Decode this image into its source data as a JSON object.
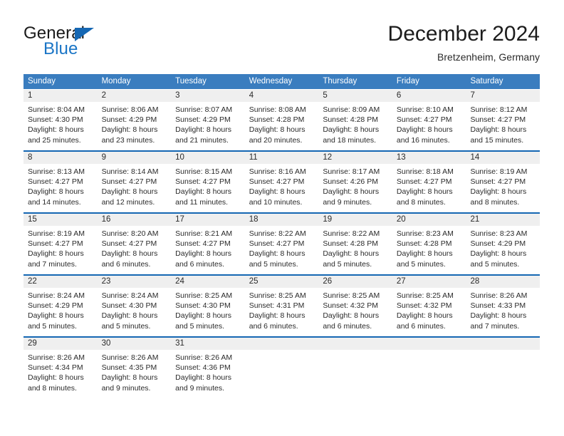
{
  "brand": {
    "name_primary": "General",
    "name_secondary": "Blue",
    "accent_color": "#1567b3"
  },
  "header": {
    "month_title": "December 2024",
    "location": "Bretzenheim, Germany"
  },
  "theme": {
    "header_blue": "#3a7dbf",
    "rule_blue": "#1567b3",
    "daynum_gray": "#efefef",
    "text_color": "#2a2a2a"
  },
  "weekdays": [
    "Sunday",
    "Monday",
    "Tuesday",
    "Wednesday",
    "Thursday",
    "Friday",
    "Saturday"
  ],
  "weeks": [
    [
      {
        "day": "1",
        "sunrise": "Sunrise: 8:04 AM",
        "sunset": "Sunset: 4:30 PM",
        "daylight_1": "Daylight: 8 hours",
        "daylight_2": "and 25 minutes."
      },
      {
        "day": "2",
        "sunrise": "Sunrise: 8:06 AM",
        "sunset": "Sunset: 4:29 PM",
        "daylight_1": "Daylight: 8 hours",
        "daylight_2": "and 23 minutes."
      },
      {
        "day": "3",
        "sunrise": "Sunrise: 8:07 AM",
        "sunset": "Sunset: 4:29 PM",
        "daylight_1": "Daylight: 8 hours",
        "daylight_2": "and 21 minutes."
      },
      {
        "day": "4",
        "sunrise": "Sunrise: 8:08 AM",
        "sunset": "Sunset: 4:28 PM",
        "daylight_1": "Daylight: 8 hours",
        "daylight_2": "and 20 minutes."
      },
      {
        "day": "5",
        "sunrise": "Sunrise: 8:09 AM",
        "sunset": "Sunset: 4:28 PM",
        "daylight_1": "Daylight: 8 hours",
        "daylight_2": "and 18 minutes."
      },
      {
        "day": "6",
        "sunrise": "Sunrise: 8:10 AM",
        "sunset": "Sunset: 4:27 PM",
        "daylight_1": "Daylight: 8 hours",
        "daylight_2": "and 16 minutes."
      },
      {
        "day": "7",
        "sunrise": "Sunrise: 8:12 AM",
        "sunset": "Sunset: 4:27 PM",
        "daylight_1": "Daylight: 8 hours",
        "daylight_2": "and 15 minutes."
      }
    ],
    [
      {
        "day": "8",
        "sunrise": "Sunrise: 8:13 AM",
        "sunset": "Sunset: 4:27 PM",
        "daylight_1": "Daylight: 8 hours",
        "daylight_2": "and 14 minutes."
      },
      {
        "day": "9",
        "sunrise": "Sunrise: 8:14 AM",
        "sunset": "Sunset: 4:27 PM",
        "daylight_1": "Daylight: 8 hours",
        "daylight_2": "and 12 minutes."
      },
      {
        "day": "10",
        "sunrise": "Sunrise: 8:15 AM",
        "sunset": "Sunset: 4:27 PM",
        "daylight_1": "Daylight: 8 hours",
        "daylight_2": "and 11 minutes."
      },
      {
        "day": "11",
        "sunrise": "Sunrise: 8:16 AM",
        "sunset": "Sunset: 4:27 PM",
        "daylight_1": "Daylight: 8 hours",
        "daylight_2": "and 10 minutes."
      },
      {
        "day": "12",
        "sunrise": "Sunrise: 8:17 AM",
        "sunset": "Sunset: 4:26 PM",
        "daylight_1": "Daylight: 8 hours",
        "daylight_2": "and 9 minutes."
      },
      {
        "day": "13",
        "sunrise": "Sunrise: 8:18 AM",
        "sunset": "Sunset: 4:27 PM",
        "daylight_1": "Daylight: 8 hours",
        "daylight_2": "and 8 minutes."
      },
      {
        "day": "14",
        "sunrise": "Sunrise: 8:19 AM",
        "sunset": "Sunset: 4:27 PM",
        "daylight_1": "Daylight: 8 hours",
        "daylight_2": "and 8 minutes."
      }
    ],
    [
      {
        "day": "15",
        "sunrise": "Sunrise: 8:19 AM",
        "sunset": "Sunset: 4:27 PM",
        "daylight_1": "Daylight: 8 hours",
        "daylight_2": "and 7 minutes."
      },
      {
        "day": "16",
        "sunrise": "Sunrise: 8:20 AM",
        "sunset": "Sunset: 4:27 PM",
        "daylight_1": "Daylight: 8 hours",
        "daylight_2": "and 6 minutes."
      },
      {
        "day": "17",
        "sunrise": "Sunrise: 8:21 AM",
        "sunset": "Sunset: 4:27 PM",
        "daylight_1": "Daylight: 8 hours",
        "daylight_2": "and 6 minutes."
      },
      {
        "day": "18",
        "sunrise": "Sunrise: 8:22 AM",
        "sunset": "Sunset: 4:27 PM",
        "daylight_1": "Daylight: 8 hours",
        "daylight_2": "and 5 minutes."
      },
      {
        "day": "19",
        "sunrise": "Sunrise: 8:22 AM",
        "sunset": "Sunset: 4:28 PM",
        "daylight_1": "Daylight: 8 hours",
        "daylight_2": "and 5 minutes."
      },
      {
        "day": "20",
        "sunrise": "Sunrise: 8:23 AM",
        "sunset": "Sunset: 4:28 PM",
        "daylight_1": "Daylight: 8 hours",
        "daylight_2": "and 5 minutes."
      },
      {
        "day": "21",
        "sunrise": "Sunrise: 8:23 AM",
        "sunset": "Sunset: 4:29 PM",
        "daylight_1": "Daylight: 8 hours",
        "daylight_2": "and 5 minutes."
      }
    ],
    [
      {
        "day": "22",
        "sunrise": "Sunrise: 8:24 AM",
        "sunset": "Sunset: 4:29 PM",
        "daylight_1": "Daylight: 8 hours",
        "daylight_2": "and 5 minutes."
      },
      {
        "day": "23",
        "sunrise": "Sunrise: 8:24 AM",
        "sunset": "Sunset: 4:30 PM",
        "daylight_1": "Daylight: 8 hours",
        "daylight_2": "and 5 minutes."
      },
      {
        "day": "24",
        "sunrise": "Sunrise: 8:25 AM",
        "sunset": "Sunset: 4:30 PM",
        "daylight_1": "Daylight: 8 hours",
        "daylight_2": "and 5 minutes."
      },
      {
        "day": "25",
        "sunrise": "Sunrise: 8:25 AM",
        "sunset": "Sunset: 4:31 PM",
        "daylight_1": "Daylight: 8 hours",
        "daylight_2": "and 6 minutes."
      },
      {
        "day": "26",
        "sunrise": "Sunrise: 8:25 AM",
        "sunset": "Sunset: 4:32 PM",
        "daylight_1": "Daylight: 8 hours",
        "daylight_2": "and 6 minutes."
      },
      {
        "day": "27",
        "sunrise": "Sunrise: 8:25 AM",
        "sunset": "Sunset: 4:32 PM",
        "daylight_1": "Daylight: 8 hours",
        "daylight_2": "and 6 minutes."
      },
      {
        "day": "28",
        "sunrise": "Sunrise: 8:26 AM",
        "sunset": "Sunset: 4:33 PM",
        "daylight_1": "Daylight: 8 hours",
        "daylight_2": "and 7 minutes."
      }
    ],
    [
      {
        "day": "29",
        "sunrise": "Sunrise: 8:26 AM",
        "sunset": "Sunset: 4:34 PM",
        "daylight_1": "Daylight: 8 hours",
        "daylight_2": "and 8 minutes."
      },
      {
        "day": "30",
        "sunrise": "Sunrise: 8:26 AM",
        "sunset": "Sunset: 4:35 PM",
        "daylight_1": "Daylight: 8 hours",
        "daylight_2": "and 9 minutes."
      },
      {
        "day": "31",
        "sunrise": "Sunrise: 8:26 AM",
        "sunset": "Sunset: 4:36 PM",
        "daylight_1": "Daylight: 8 hours",
        "daylight_2": "and 9 minutes."
      },
      {
        "day": "",
        "sunrise": "",
        "sunset": "",
        "daylight_1": "",
        "daylight_2": ""
      },
      {
        "day": "",
        "sunrise": "",
        "sunset": "",
        "daylight_1": "",
        "daylight_2": ""
      },
      {
        "day": "",
        "sunrise": "",
        "sunset": "",
        "daylight_1": "",
        "daylight_2": ""
      },
      {
        "day": "",
        "sunrise": "",
        "sunset": "",
        "daylight_1": "",
        "daylight_2": ""
      }
    ]
  ]
}
